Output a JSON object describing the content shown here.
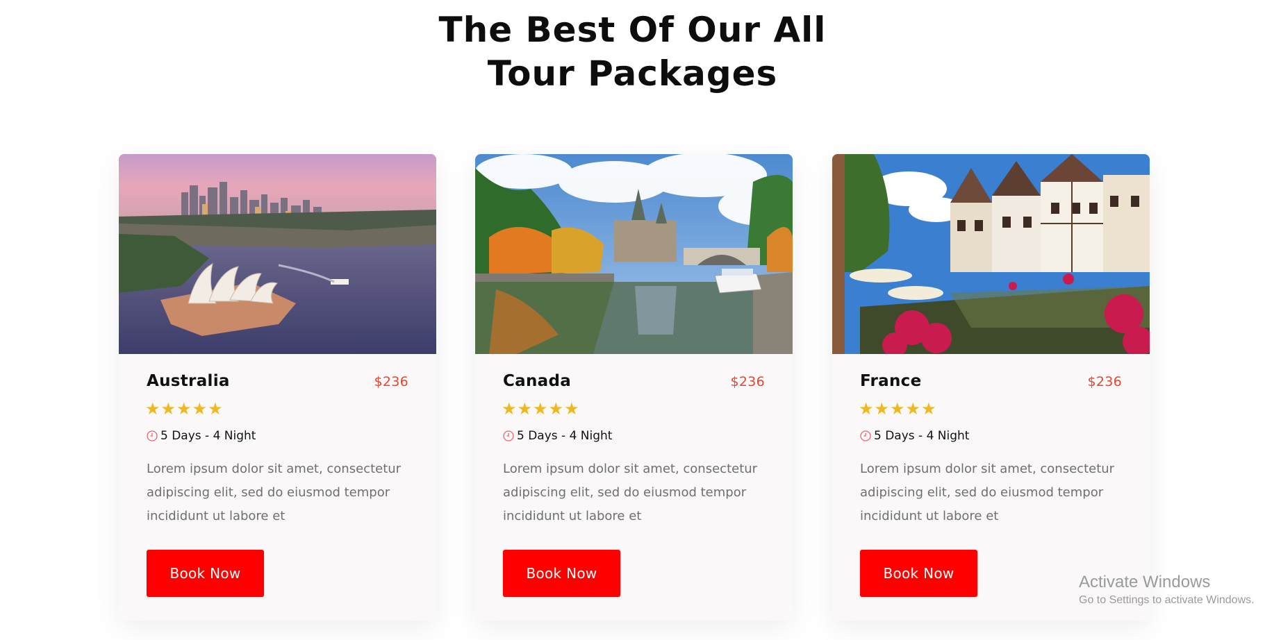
{
  "section": {
    "heading_line1": "The Best Of Our All",
    "heading_line2": "Tour Packages"
  },
  "colors": {
    "price": "#e9452f",
    "star": "#efb81f",
    "button": "#ff0000",
    "card_bg": "#faf8f8"
  },
  "packages": [
    {
      "image": "sydney-opera-house-photo",
      "title": "Australia",
      "price": "$236",
      "rating": 5,
      "duration": "5 Days - 4 Night",
      "description": "Lorem ipsum dolor sit amet, consectetur adipiscing elit, sed do eiusmod tempor incididunt ut labore et",
      "button_label": "Book Now"
    },
    {
      "image": "ottawa-canal-parliament-photo",
      "title": "Canada",
      "price": "$236",
      "rating": 5,
      "duration": "5 Days - 4 Night",
      "description": "Lorem ipsum dolor sit amet, consectetur adipiscing elit, sed do eiusmod tempor incididunt ut labore et",
      "button_label": "Book Now"
    },
    {
      "image": "colmar-canal-houses-photo",
      "title": "France",
      "price": "$236",
      "rating": 5,
      "duration": "5 Days - 4 Night",
      "description": "Lorem ipsum dolor sit amet, consectetur adipiscing elit, sed do eiusmod tempor incididunt ut labore et",
      "button_label": "Book Now"
    }
  ],
  "watermark": {
    "title": "Activate Windows",
    "subtitle": "Go to Settings to activate Windows."
  }
}
